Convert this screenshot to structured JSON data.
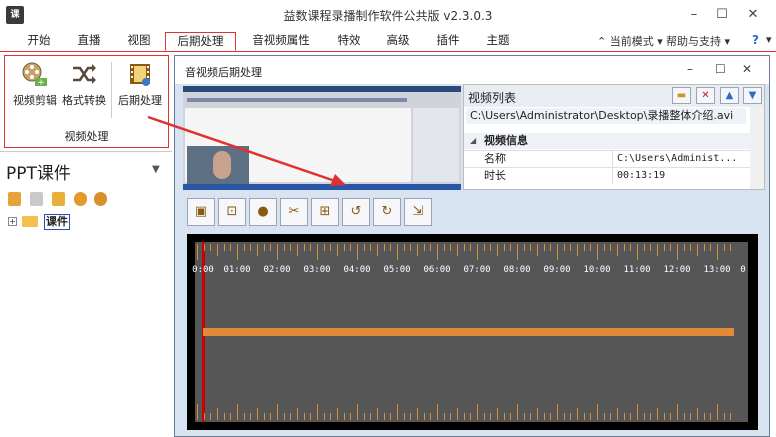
{
  "app": {
    "icon_text": "课",
    "title": "益数课程录播制作软件公共版 v2.3.0.3"
  },
  "ribbon_tabs": [
    {
      "label": "开始"
    },
    {
      "label": "直播"
    },
    {
      "label": "视图"
    },
    {
      "label": "后期处理",
      "active": true
    },
    {
      "label": "音视频属性"
    },
    {
      "label": "特效"
    },
    {
      "label": "高级"
    },
    {
      "label": "插件"
    },
    {
      "label": "主题"
    }
  ],
  "ribbon_right": {
    "mode_label": "当前模式",
    "help_label": "帮助与支持"
  },
  "ribbon_group": {
    "label": "视频处理",
    "buttons": [
      {
        "label": "视频剪辑",
        "icon": "film-reel-icon"
      },
      {
        "label": "格式转换",
        "icon": "shuffle-icon"
      },
      {
        "label": "后期处理",
        "icon": "film-edit-icon"
      }
    ]
  },
  "left_pane": {
    "title": "PPT课件",
    "tree_root_label": "课件"
  },
  "dialog": {
    "title": "音视频后期处理",
    "video_list": {
      "title": "视频列表",
      "items": [
        "C:\\Users\\Administrator\\Desktop\\录播整体介绍.avi"
      ]
    },
    "info": {
      "section_title": "视频信息",
      "rows": [
        {
          "key": "名称",
          "value": "C:\\Users\\Administ..."
        },
        {
          "key": "时长",
          "value": "00:13:19"
        }
      ]
    },
    "timeline": {
      "labels": [
        "0:00",
        "01:00",
        "02:00",
        "03:00",
        "04:00",
        "05:00",
        "06:00",
        "07:00",
        "08:00",
        "09:00",
        "10:00",
        "11:00",
        "12:00",
        "13:00"
      ],
      "trailing_label": "0",
      "cursor_position": "0:00",
      "track_start": "0:00",
      "track_end": "13:19"
    }
  },
  "colors": {
    "accent_red": "#dd3333",
    "timeline_bg": "#565656",
    "track": "#e08a3a",
    "dialog_body": "#d7e3f1"
  }
}
